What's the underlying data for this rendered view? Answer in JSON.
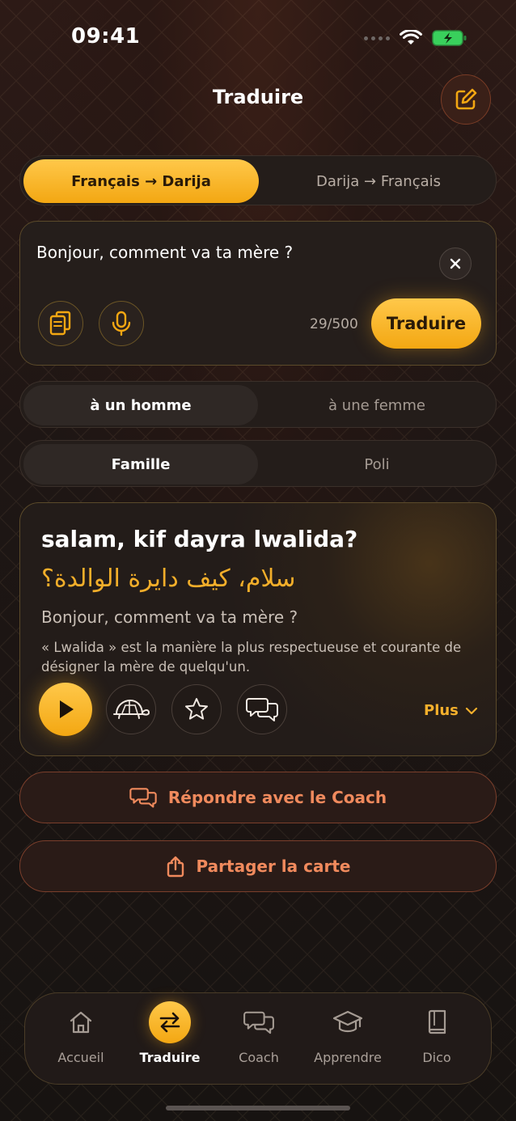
{
  "status": {
    "time": "09:41"
  },
  "header": {
    "title": "Traduire",
    "edit_icon": "edit-icon"
  },
  "direction": {
    "active": "Français → Darija",
    "inactive": "Darija → Français"
  },
  "input": {
    "text": "Bonjour, comment va ta mère ?",
    "count": "29/500",
    "translate_label": "Traduire"
  },
  "gender": {
    "active": "à un homme",
    "inactive": "à une femme"
  },
  "register": {
    "active": "Famille",
    "inactive": "Poli"
  },
  "result": {
    "latin": "salam, kif dayra lwalida?",
    "arabic": "سلام، كيف دايرة الوالدة؟",
    "french": "Bonjour, comment va ta mère ?",
    "note": "« Lwalida » est la manière la plus respectueuse et courante de désigner la mère de quelqu'un.",
    "more_label": "Plus"
  },
  "actions": {
    "coach_label": "Répondre avec le Coach",
    "share_label": "Partager la carte"
  },
  "nav": {
    "items": [
      {
        "label": "Accueil",
        "icon": "home-icon"
      },
      {
        "label": "Traduire",
        "icon": "swap-icon",
        "active": true
      },
      {
        "label": "Coach",
        "icon": "chat-icon"
      },
      {
        "label": "Apprendre",
        "icon": "graduation-cap-icon"
      },
      {
        "label": "Dico",
        "icon": "book-icon"
      }
    ]
  },
  "colors": {
    "accent": "#f3a712",
    "coral": "#f08a5d",
    "background": "#1b1412"
  }
}
